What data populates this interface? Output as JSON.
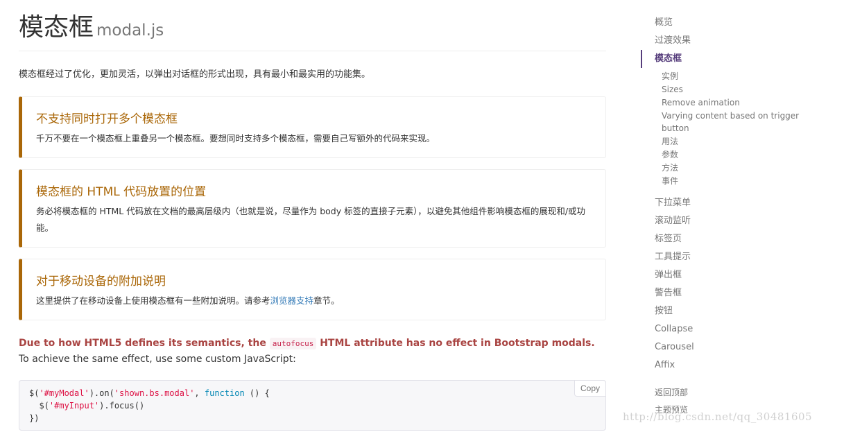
{
  "header": {
    "title": "模态框",
    "subtitle": "modal.js"
  },
  "lead": "模态框经过了优化，更加灵活，以弹出对话框的形式出现，具有最小和最实用的功能集。",
  "callouts": [
    {
      "title": "不支持同时打开多个模态框",
      "text": "千万不要在一个模态框上重叠另一个模态框。要想同时支持多个模态框，需要自己写额外的代码来实现。"
    },
    {
      "title": "模态框的 HTML 代码放置的位置",
      "text": "务必将模态框的 HTML 代码放在文档的最高层级内（也就是说，尽量作为 body 标签的直接子元素），以避免其他组件影响模态框的展现和/或功能。"
    },
    {
      "title": "对于移动设备的附加说明",
      "text_before": "这里提供了在移动设备上使用模态框有一些附加说明。请参考",
      "link": "浏览器支持",
      "text_after": "章节。"
    }
  ],
  "note": {
    "warn_before": "Due to how HTML5 defines its semantics, the",
    "code": "autofocus",
    "warn_after": "HTML attribute has no effect in Bootstrap modals.",
    "rest": "To achieve the same effect, use some custom JavaScript:"
  },
  "code": {
    "line1_a": "$(",
    "line1_s1": "'#myModal'",
    "line1_b": ").on(",
    "line1_s2": "'shown.bs.modal'",
    "line1_c": ", ",
    "line1_kw": "function",
    "line1_d": " () {",
    "line2_a": "  $(",
    "line2_s": "'#myInput'",
    "line2_b": ").focus()",
    "line3": "})",
    "copy_label": "Copy"
  },
  "sidebar": {
    "items_top": [
      "概览",
      "过渡效果"
    ],
    "active": "模态框",
    "subitems": [
      "实例",
      "Sizes",
      "Remove animation",
      "Varying content based on trigger button",
      "用法",
      "参数",
      "方法",
      "事件"
    ],
    "items_after": [
      "下拉菜单",
      "滚动监听",
      "标签页",
      "工具提示",
      "弹出框",
      "警告框",
      "按钮",
      "Collapse",
      "Carousel",
      "Affix"
    ],
    "bottom": [
      "返回顶部",
      "主题预览"
    ]
  },
  "watermark": "http://blog.csdn.net/qq_30481605",
  "colors": {
    "callout_warning": "#aa6708",
    "active_nav": "#563d7c",
    "link": "#337ab7",
    "danger": "#a94442"
  }
}
